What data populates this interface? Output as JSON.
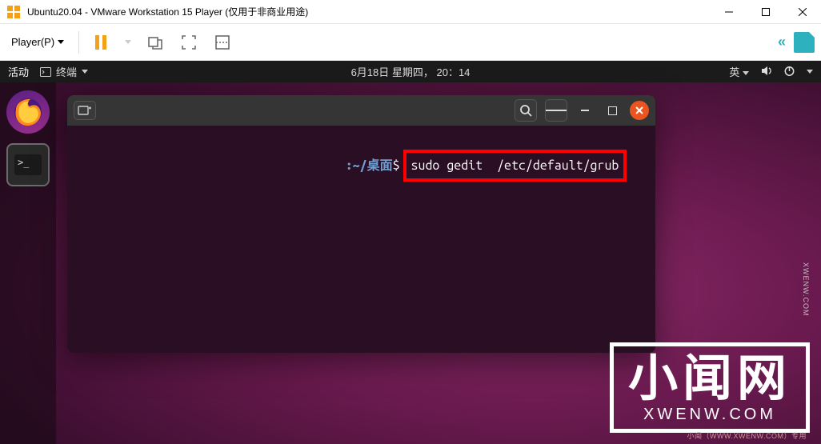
{
  "window": {
    "title": "Ubuntu20.04 - VMware Workstation 15 Player (仅用于非商业用途)"
  },
  "vmware": {
    "menu_label": "Player(P)"
  },
  "ubuntu": {
    "activities": "活动",
    "app_name": "终端",
    "datetime": "6月18日 星期四， 20：14",
    "input_lang": "英"
  },
  "terminal": {
    "prompt_path": ":~/桌面",
    "dollar": "$",
    "command": "sudo gedit  /etc/default/grub"
  },
  "watermark": {
    "cn": "小闻网",
    "en": "XWENW.COM",
    "side": "XWENW.COM",
    "footer": "小闻（WWW.XWENW.COM）专用"
  }
}
